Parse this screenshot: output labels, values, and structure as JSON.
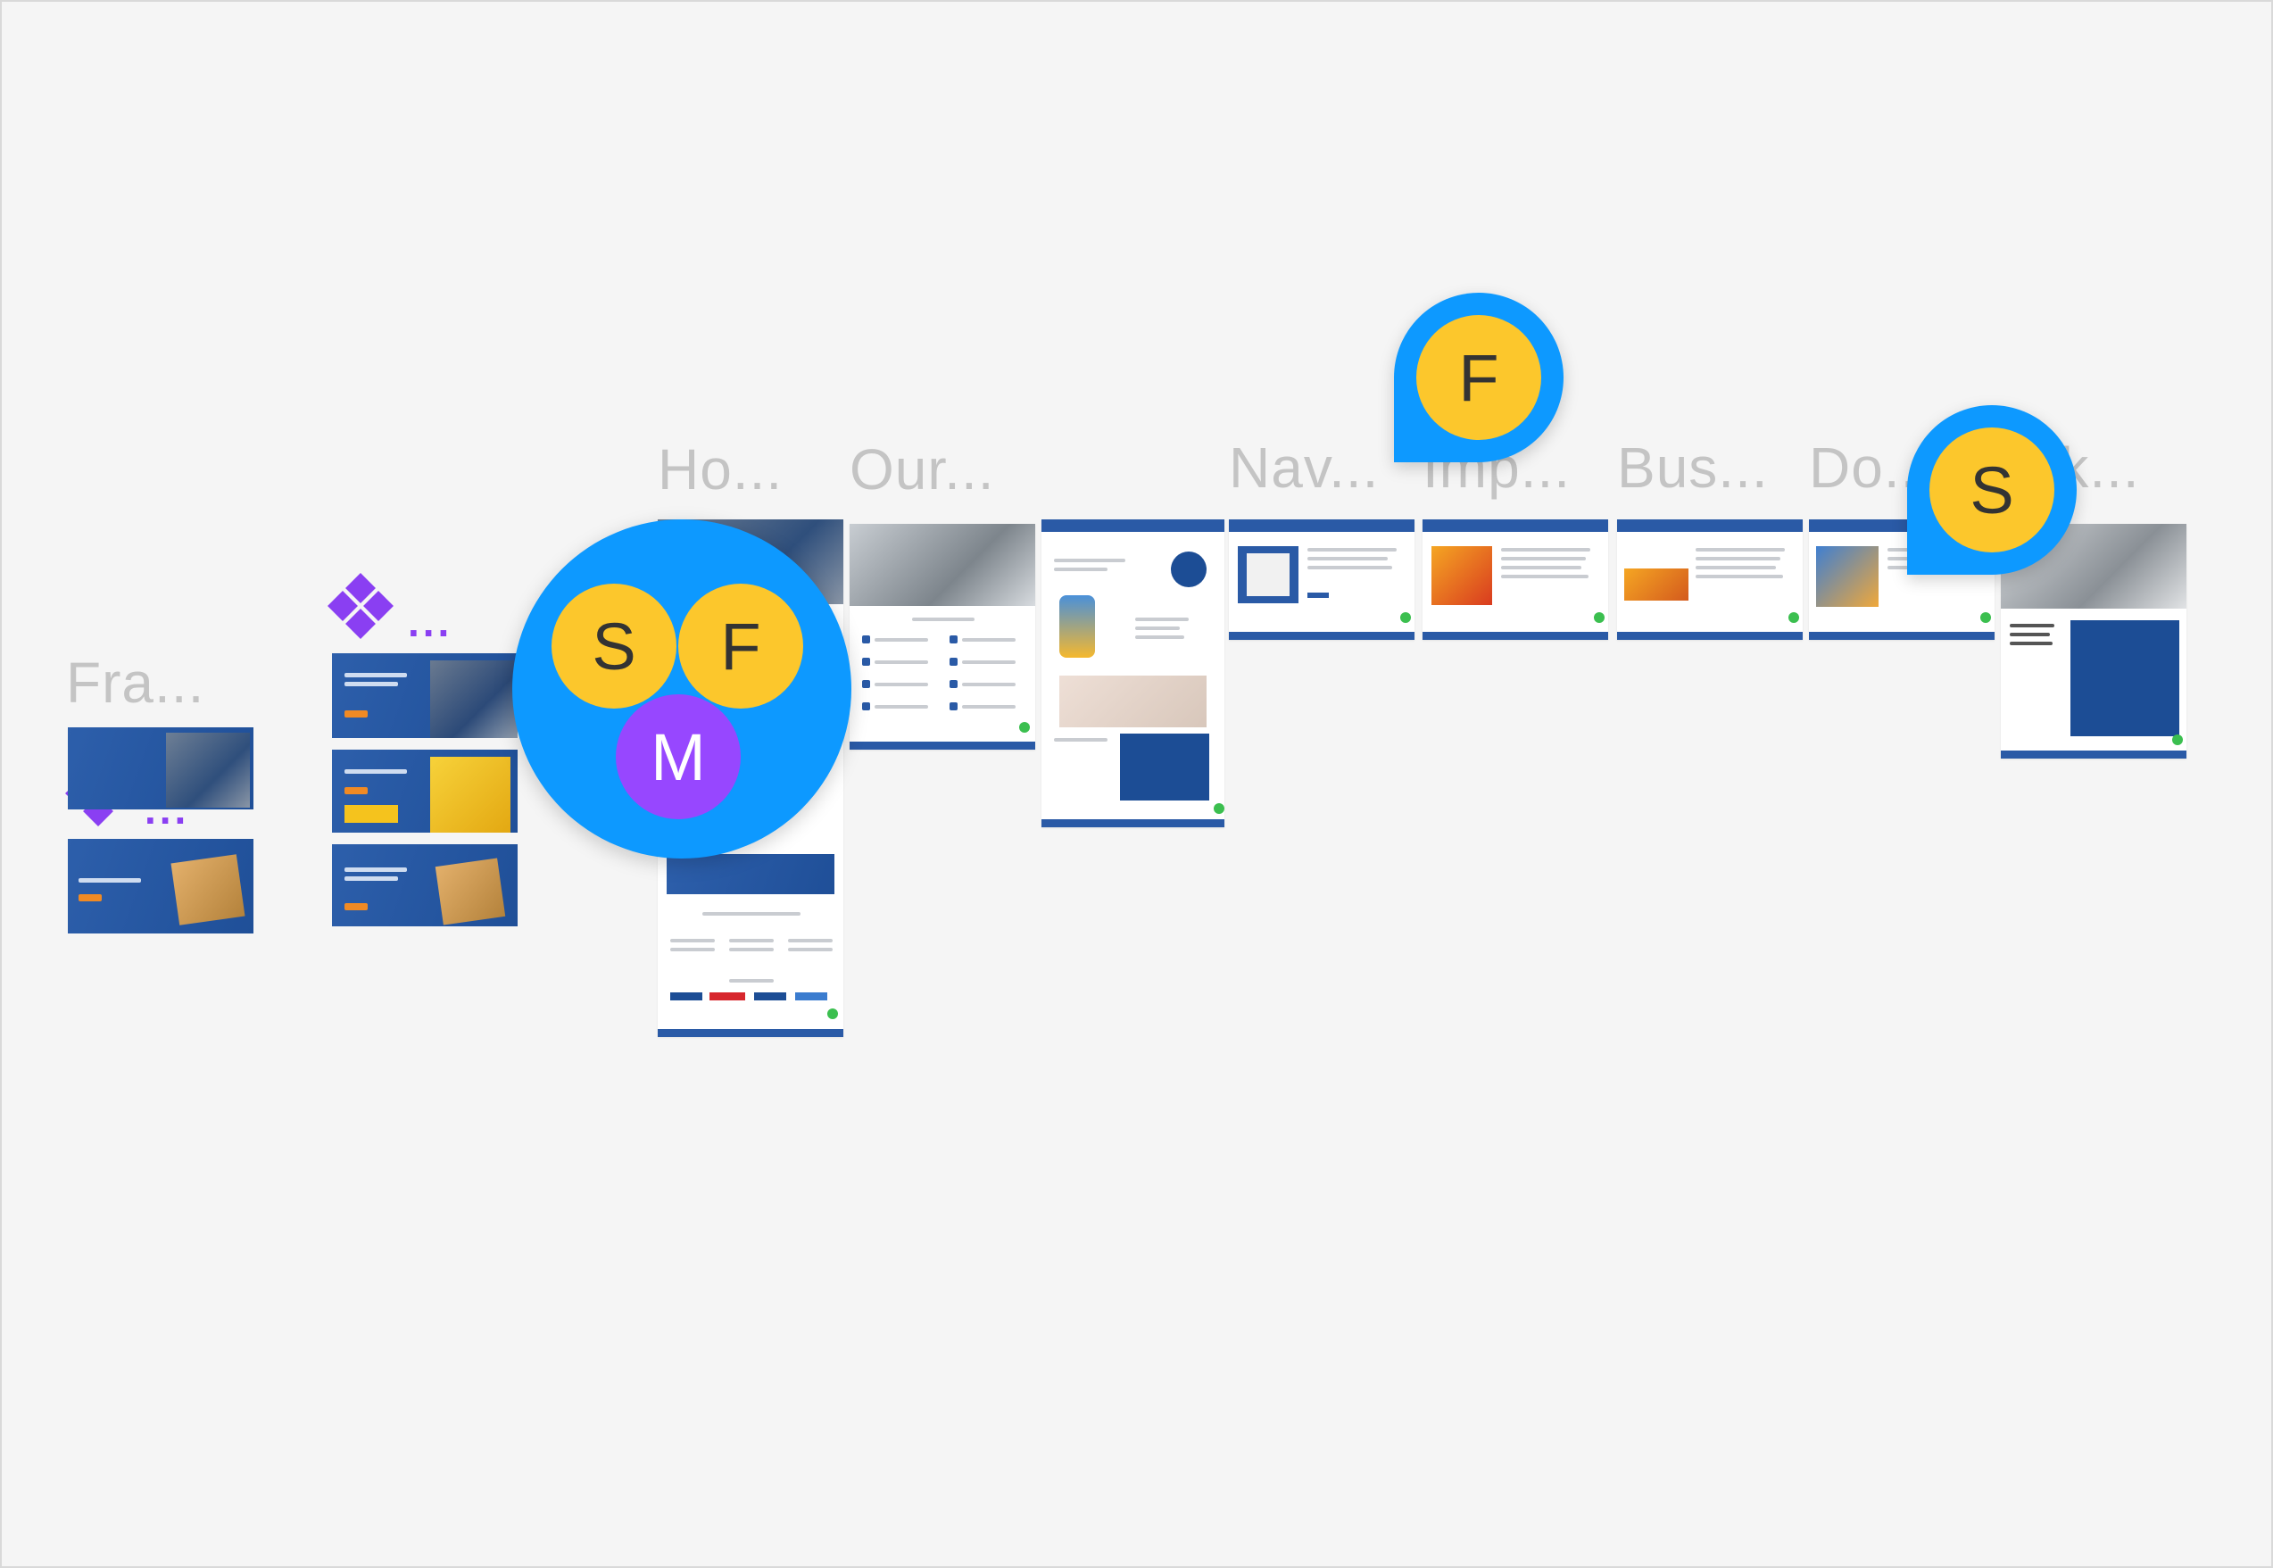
{
  "canvas": {
    "background": "#f5f5f5",
    "accent_blue": "#0d99ff",
    "brand_blue": "#2a5aa6",
    "component_purple": "#8a3ff2"
  },
  "frames": {
    "labels": [
      {
        "id": "fra",
        "text": "Fra..."
      },
      {
        "id": "component",
        "text": "..."
      },
      {
        "id": "home",
        "text": "Ho..."
      },
      {
        "id": "our",
        "text": "Our..."
      },
      {
        "id": "nav",
        "text": "Nav..."
      },
      {
        "id": "imp",
        "text": "Imp..."
      },
      {
        "id": "bus",
        "text": "Bus..."
      },
      {
        "id": "do",
        "text": "Do..."
      },
      {
        "id": "k",
        "text": "...k..."
      }
    ],
    "count": 11
  },
  "collaborators": {
    "cluster": [
      {
        "initial": "S",
        "color": "#fcc72c"
      },
      {
        "initial": "F",
        "color": "#fcc72c"
      },
      {
        "initial": "M",
        "color": "#9747ff"
      }
    ],
    "pins": [
      {
        "initial": "F",
        "color": "#fcc72c"
      },
      {
        "initial": "S",
        "color": "#fcc72c"
      }
    ]
  }
}
